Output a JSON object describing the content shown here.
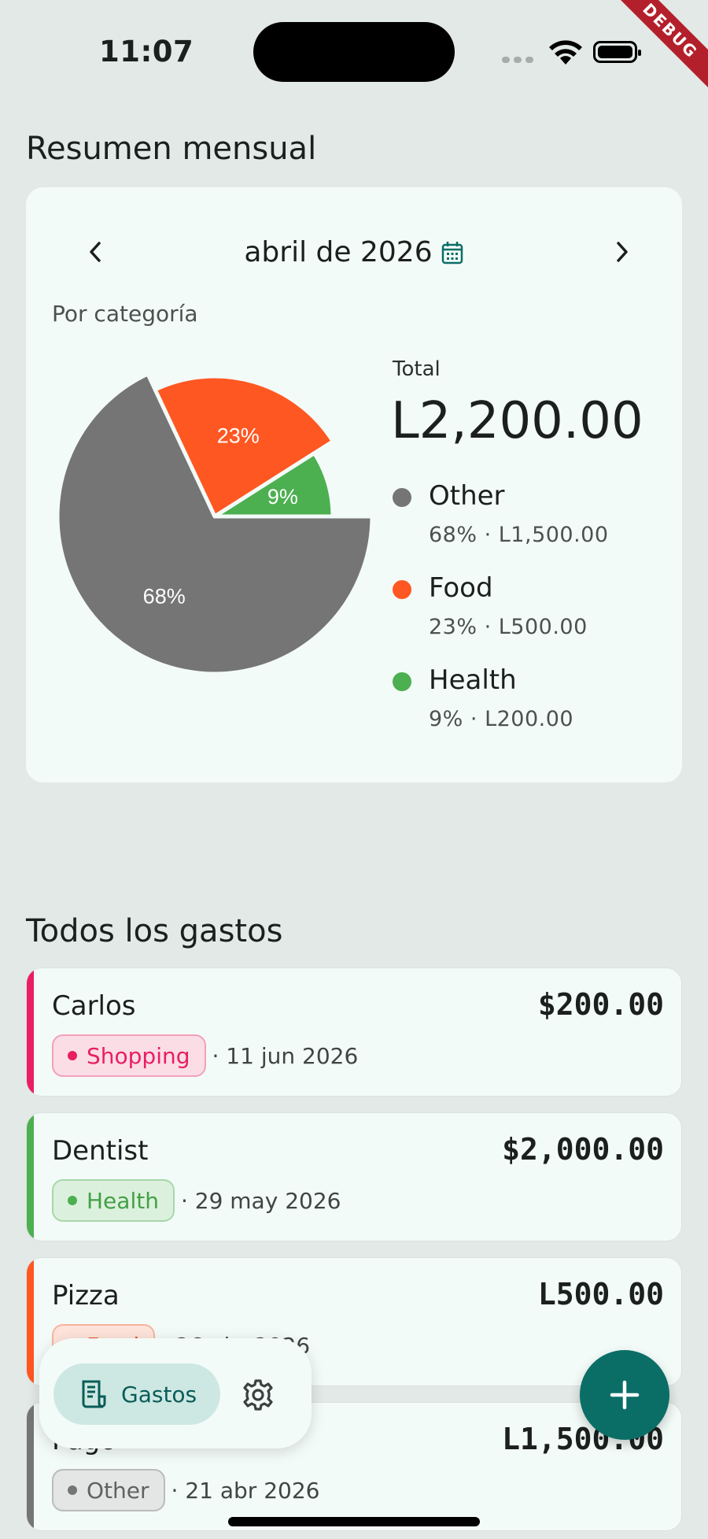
{
  "status_bar": {
    "time": "11:07",
    "debug_label": "DEBUG"
  },
  "summary": {
    "section_title": "Resumen mensual",
    "month_label": "abril de 2026",
    "by_category_label": "Por categoría",
    "total_label": "Total",
    "total_value": "L2,200.00",
    "legend": [
      {
        "name": "Other",
        "detail": "68% · L1,500.00",
        "color": "#757575"
      },
      {
        "name": "Food",
        "detail": "23% · L500.00",
        "color": "#ff5722"
      },
      {
        "name": "Health",
        "detail": "9% · L200.00",
        "color": "#4caf50"
      }
    ]
  },
  "chart_data": {
    "type": "pie",
    "categories": [
      "Other",
      "Food",
      "Health"
    ],
    "values": [
      68,
      23,
      9
    ],
    "labels": [
      "68%",
      "23%",
      "9%"
    ],
    "colors": [
      "#757575",
      "#ff5722",
      "#4caf50"
    ]
  },
  "expenses": {
    "section_title": "Todos los gastos",
    "items": [
      {
        "name": "Carlos",
        "amount": "$200.00",
        "category": "Shopping",
        "date": "· 11 jun 2026",
        "color": "#e91e63",
        "chip_bg": "#fbdde6"
      },
      {
        "name": "Dentist",
        "amount": "$2,000.00",
        "category": "Health",
        "date": "· 29 may 2026",
        "color": "#4caf50",
        "chip_bg": "#dcf1dd"
      },
      {
        "name": "Pizza",
        "amount": "L500.00",
        "category": "Food",
        "date": "· 26 abr 2026",
        "color": "#ff5722",
        "chip_bg": "#fde3d9"
      },
      {
        "name": "Pago",
        "amount": "L1,500.00",
        "category": "Other",
        "date": "· 21 abr 2026",
        "color": "#757575",
        "chip_bg": "#e4e6e5"
      }
    ]
  },
  "bottom_nav": {
    "gastos_label": "Gastos"
  }
}
